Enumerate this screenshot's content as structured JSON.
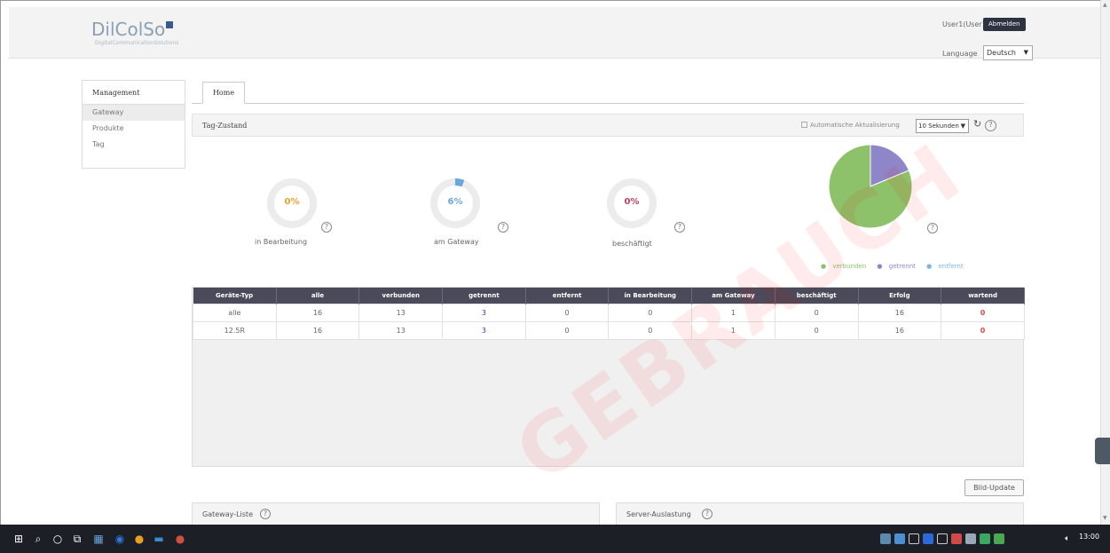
{
  "header": {
    "logo_text": "DilColSo",
    "logo_sub": "DigitalCommunicationSolutions",
    "user": "User1(User1)",
    "logout_label": "Abmelden",
    "language_label": "Language",
    "language_value": "Deutsch"
  },
  "sidebar": {
    "title": "Management",
    "items": [
      {
        "label": "Gateway"
      },
      {
        "label": "Produkte"
      },
      {
        "label": "Tag"
      }
    ]
  },
  "tabs": [
    {
      "label": "Home"
    }
  ],
  "status_panel": {
    "title": "Tag-Zustand",
    "auto_refresh_label": "Automatische Aktualisierung",
    "interval_value": "10 Sekunden",
    "refresh_icon": "refresh-icon",
    "help_icon": "help-icon"
  },
  "gauges": [
    {
      "value": "0%",
      "label": "in Bearbeitung",
      "fraction": 0.0,
      "color": "#f0a030"
    },
    {
      "value": "6%",
      "label": "am Gateway",
      "fraction": 0.06,
      "color": "#6aa6e0"
    },
    {
      "value": "0%",
      "label": "beschäftigt",
      "fraction": 0.0,
      "color": "#c04060"
    }
  ],
  "pie": {
    "legend": [
      {
        "label": "verbunden",
        "color": "#8dc26a",
        "value": 13
      },
      {
        "label": "getrennt",
        "color": "#8f86c9",
        "value": 3
      },
      {
        "label": "entfernt",
        "color": "#7bb4e6",
        "value": 0
      }
    ]
  },
  "table": {
    "headers": [
      "Geräte-Typ",
      "alle",
      "verbunden",
      "getrennt",
      "entfernt",
      "in Bearbeitung",
      "am Gateway",
      "beschäftigt",
      "Erfolg",
      "wartend"
    ],
    "rows": [
      [
        "alle",
        "16",
        "13",
        "3",
        "0",
        "0",
        "1",
        "0",
        "16",
        "0"
      ],
      [
        "12.5R",
        "16",
        "13",
        "3",
        "0",
        "0",
        "1",
        "0",
        "16",
        "0"
      ]
    ]
  },
  "update_button": "Bild-Update",
  "bottom_panels": [
    {
      "title": "Gateway-Liste"
    },
    {
      "title": "Server-Auslastung"
    }
  ],
  "taskbar": {
    "clock": "13:00"
  }
}
